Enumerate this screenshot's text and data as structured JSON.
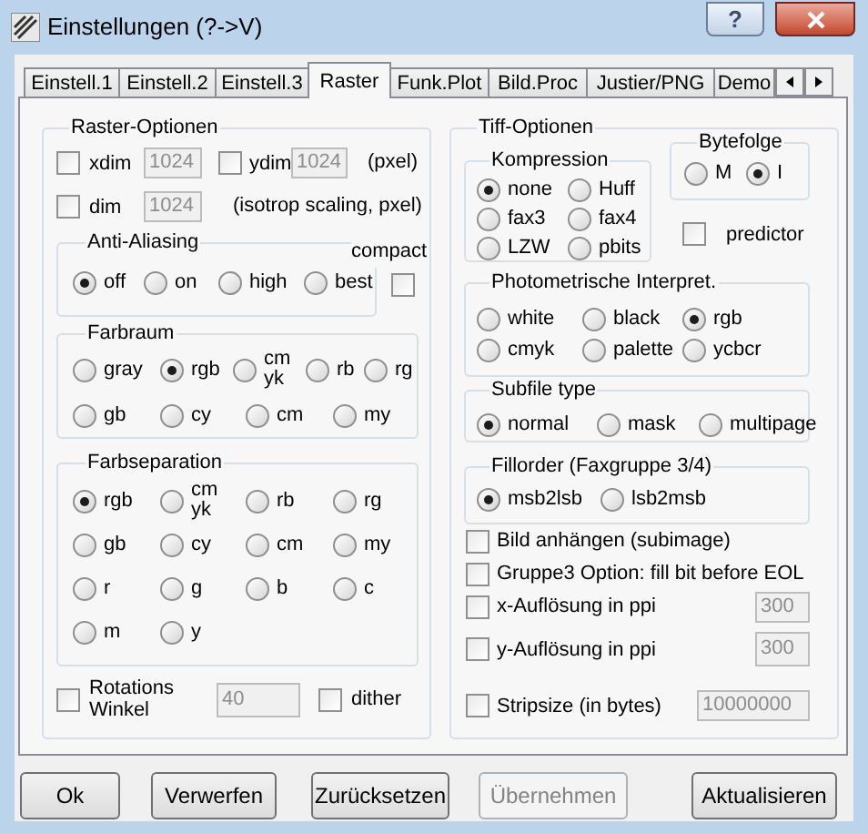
{
  "window": {
    "title": "Einstellungen (?->V)",
    "help_button": "?"
  },
  "tabs": [
    {
      "label": "Einstell.1",
      "selected": false
    },
    {
      "label": "Einstell.2",
      "selected": false
    },
    {
      "label": "Einstell.3",
      "selected": false
    },
    {
      "label": "Raster",
      "selected": true
    },
    {
      "label": "Funk.Plot",
      "selected": false
    },
    {
      "label": "Bild.Proc",
      "selected": false
    },
    {
      "label": "Justier/PNG",
      "selected": false
    },
    {
      "label": "Demo",
      "selected": false
    }
  ],
  "raster_options": {
    "title": "Raster-Optionen",
    "xdim": {
      "label": "xdim",
      "checked": false,
      "field": {
        "value": "1024",
        "disabled": true
      }
    },
    "ydim": {
      "label": "ydim",
      "checked": false,
      "field": {
        "value": "1024",
        "disabled": true
      }
    },
    "ydim_unit": "(pxel)",
    "dim": {
      "label": "dim",
      "checked": false,
      "field": {
        "value": "1024",
        "disabled": true
      }
    },
    "dim_note": "(isotrop scaling, pxel)",
    "anti_aliasing": {
      "title": "Anti-Aliasing",
      "options": [
        {
          "label": "off",
          "selected": true
        },
        {
          "label": "on",
          "selected": false
        },
        {
          "label": "high",
          "selected": false
        },
        {
          "label": "best",
          "selected": false
        }
      ]
    },
    "compact": {
      "label": "compact",
      "checked": false
    },
    "farbraum": {
      "title": "Farbraum",
      "rows": [
        [
          {
            "label": "gray",
            "selected": false
          },
          {
            "label": "rgb",
            "selected": true
          },
          {
            "label": "cm\nyk",
            "selected": false
          },
          {
            "label": "rb",
            "selected": false
          },
          {
            "label": "rg",
            "selected": false
          }
        ],
        [
          {
            "label": "gb",
            "selected": false
          },
          {
            "label": "cy",
            "selected": false
          },
          {
            "label": "cm",
            "selected": false
          },
          {
            "label": "my",
            "selected": false
          }
        ]
      ]
    },
    "farbseparation": {
      "title": "Farbseparation",
      "rows": [
        [
          {
            "label": "rgb",
            "selected": true
          },
          {
            "label": "cm\nyk",
            "selected": false
          },
          {
            "label": "rb",
            "selected": false
          },
          {
            "label": "rg",
            "selected": false
          }
        ],
        [
          {
            "label": "gb",
            "selected": false
          },
          {
            "label": "cy",
            "selected": false
          },
          {
            "label": "cm",
            "selected": false
          },
          {
            "label": "my",
            "selected": false
          }
        ],
        [
          {
            "label": "r",
            "selected": false
          },
          {
            "label": "g",
            "selected": false
          },
          {
            "label": "b",
            "selected": false
          },
          {
            "label": "c",
            "selected": false
          }
        ],
        [
          {
            "label": "m",
            "selected": false
          },
          {
            "label": "y",
            "selected": false
          }
        ]
      ]
    },
    "rotation": {
      "label": "Rotations\nWinkel",
      "checked": false,
      "field": {
        "value": "40",
        "disabled": true
      }
    },
    "dither": {
      "label": "dither",
      "checked": false
    }
  },
  "tiff_options": {
    "title": "Tiff-Optionen",
    "kompression": {
      "title": "Kompression",
      "options": [
        {
          "label": "none",
          "selected": true
        },
        {
          "label": "Huff",
          "selected": false
        },
        {
          "label": "fax3",
          "selected": false
        },
        {
          "label": "fax4",
          "selected": false
        },
        {
          "label": "LZW",
          "selected": false
        },
        {
          "label": "pbits",
          "selected": false
        }
      ]
    },
    "bytefolge": {
      "title": "Bytefolge",
      "options": [
        {
          "label": "M",
          "selected": false
        },
        {
          "label": "I",
          "selected": true
        }
      ]
    },
    "predictor": {
      "label": "predictor",
      "checked": false
    },
    "photometric": {
      "title": "Photometrische Interpret.",
      "options": [
        {
          "label": "white",
          "selected": false
        },
        {
          "label": "black",
          "selected": false
        },
        {
          "label": "rgb",
          "selected": true
        },
        {
          "label": "cmyk",
          "selected": false
        },
        {
          "label": "palette",
          "selected": false
        },
        {
          "label": "ycbcr",
          "selected": false
        }
      ]
    },
    "subfile": {
      "title": "Subfile type",
      "options": [
        {
          "label": "normal",
          "selected": true
        },
        {
          "label": "mask",
          "selected": false
        },
        {
          "label": "multipage",
          "selected": false
        }
      ]
    },
    "fillorder": {
      "title": "Fillorder (Faxgruppe 3/4)",
      "options": [
        {
          "label": "msb2lsb",
          "selected": true
        },
        {
          "label": "lsb2msb",
          "selected": false
        }
      ]
    },
    "checks": [
      {
        "label": "Bild anhängen (subimage)",
        "checked": false
      },
      {
        "label": "Gruppe3 Option: fill bit before EOL",
        "checked": false
      },
      {
        "label": "x-Auflösung in ppi",
        "checked": false,
        "field": {
          "value": "300",
          "disabled": true
        }
      },
      {
        "label": "y-Auflösung in ppi",
        "checked": false,
        "field": {
          "value": "300",
          "disabled": true
        }
      },
      {
        "label": "Stripsize (in bytes)",
        "checked": false,
        "field": {
          "value": "10000000",
          "disabled": true
        }
      }
    ]
  },
  "buttons": [
    {
      "label": "Ok",
      "disabled": false
    },
    {
      "label": "Verwerfen",
      "disabled": false
    },
    {
      "label": "Zurücksetzen",
      "disabled": false
    },
    {
      "label": "Übernehmen",
      "disabled": true
    },
    {
      "label": "Aktualisieren",
      "disabled": false
    }
  ]
}
